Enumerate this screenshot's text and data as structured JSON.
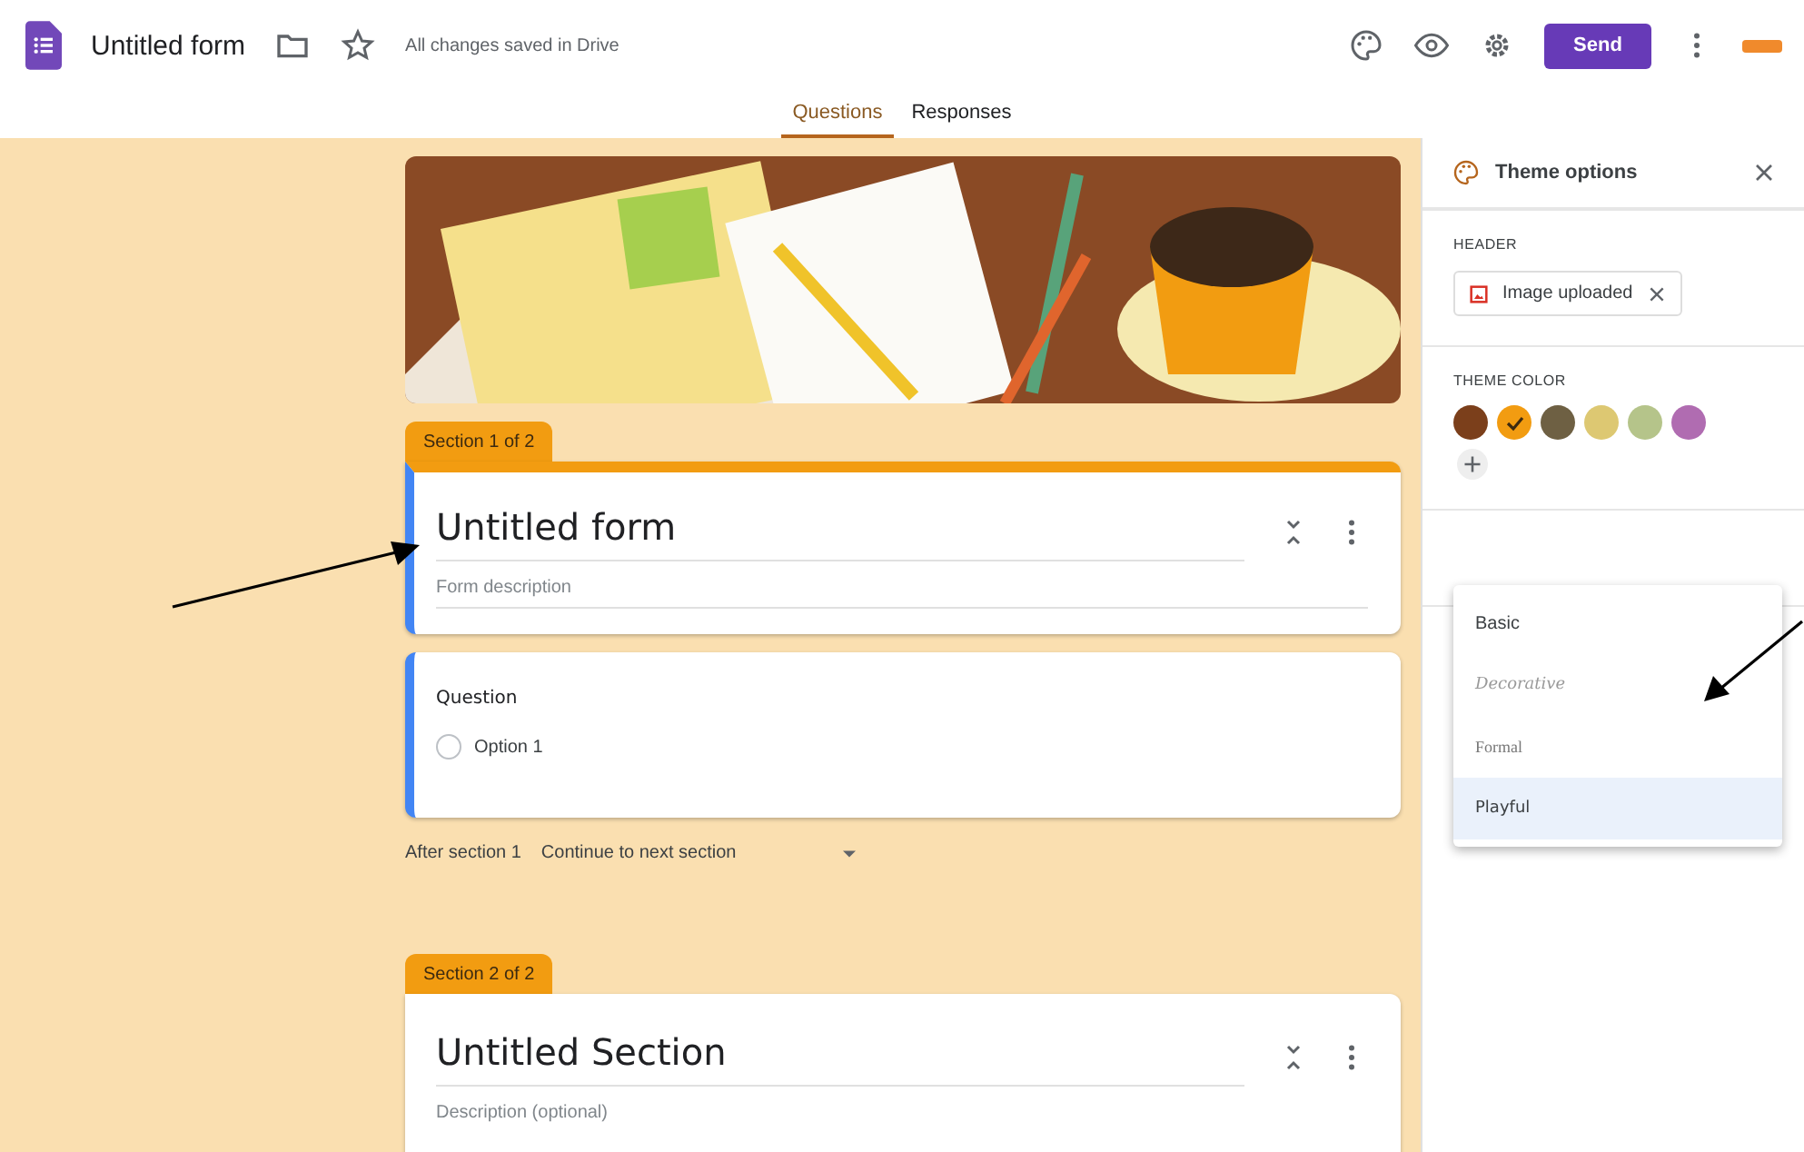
{
  "app_bar": {
    "title": "Untitled form",
    "save_status": "All changes saved in Drive",
    "send_button": "Send"
  },
  "tabs": [
    {
      "label": "Questions",
      "selected": true
    },
    {
      "label": "Responses",
      "selected": false
    }
  ],
  "sections": [
    {
      "tab": "Section 1 of 2",
      "active": true,
      "title": "Untitled form",
      "description_placeholder": "Form description",
      "questions": [
        {
          "title": "Question",
          "options": [
            {
              "label": "Option 1",
              "checked": false
            }
          ]
        }
      ],
      "after": {
        "label": "After section 1",
        "value": "Continue to next section"
      }
    },
    {
      "tab": "Section 2 of 2",
      "active": false,
      "title": "Untitled Section",
      "description_placeholder": "Description (optional)"
    }
  ],
  "theme_panel": {
    "title": "Theme options",
    "header_label": "HEADER",
    "header_chip": "Image uploaded",
    "theme_color_label": "THEME COLOR",
    "colors": [
      {
        "color": "#7b3f1b",
        "selected": false
      },
      {
        "color": "#f29c11",
        "selected": true
      },
      {
        "color": "#6e6043",
        "selected": false
      },
      {
        "color": "#ddc872",
        "selected": false
      },
      {
        "color": "#b5c48a",
        "selected": false
      },
      {
        "color": "#b06cb1",
        "selected": false
      }
    ],
    "font_menu": [
      {
        "label": "Basic",
        "kind": "basic",
        "selected": false
      },
      {
        "label": "Decorative",
        "kind": "decorative",
        "selected": false
      },
      {
        "label": "Formal",
        "kind": "formal",
        "selected": false
      },
      {
        "label": "Playful",
        "kind": "playful",
        "selected": true
      }
    ]
  }
}
